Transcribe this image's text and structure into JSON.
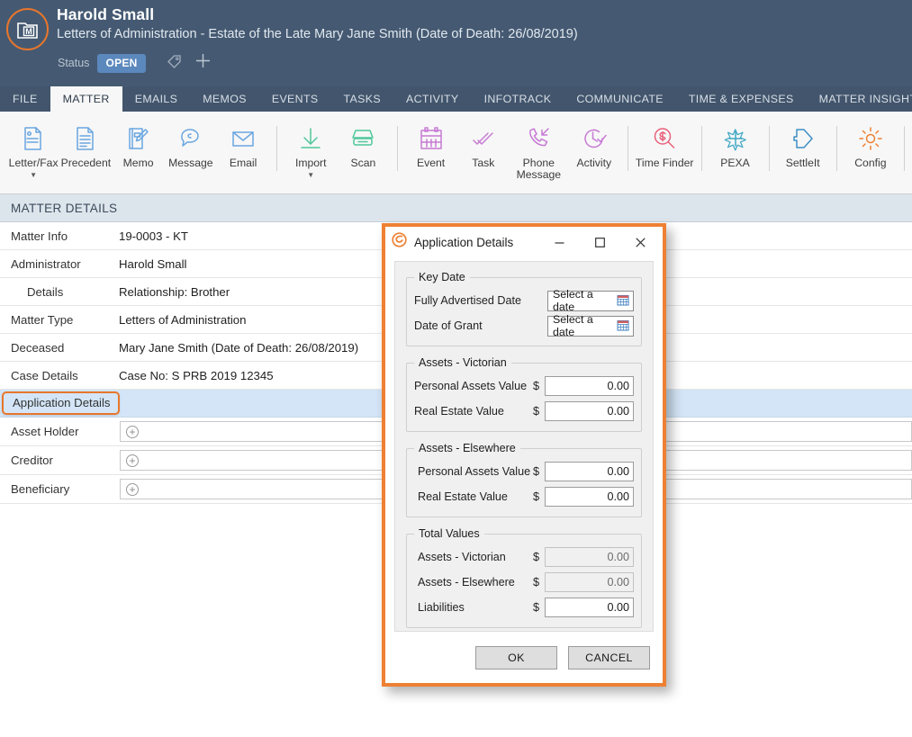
{
  "header": {
    "logo_icon": "matter-folder-m-icon",
    "client_name": "Harold Small",
    "matter_description": "Letters of Administration - Estate of the Late Mary Jane Smith (Date of Death: 26/08/2019)",
    "status_label": "Status",
    "status_value": "OPEN",
    "tag_icon": "tag-icon",
    "add_tag_icon": "plus-icon",
    "accent_color": "#e8762c",
    "background_color": "#455a72"
  },
  "tabs": [
    {
      "label": "FILE",
      "active": false
    },
    {
      "label": "MATTER",
      "active": true
    },
    {
      "label": "EMAILS",
      "active": false
    },
    {
      "label": "MEMOS",
      "active": false
    },
    {
      "label": "EVENTS",
      "active": false
    },
    {
      "label": "TASKS",
      "active": false
    },
    {
      "label": "ACTIVITY",
      "active": false
    },
    {
      "label": "INFOTRACK",
      "active": false
    },
    {
      "label": "COMMUNICATE",
      "active": false
    },
    {
      "label": "TIME & EXPENSES",
      "active": false
    },
    {
      "label": "MATTER INSIGHTS",
      "active": false
    }
  ],
  "ribbon": [
    {
      "label": "Letter/Fax",
      "icon": "letter-fax-icon",
      "color": "#6aa6e0",
      "caret": true
    },
    {
      "label": "Precedent",
      "icon": "precedent-document-icon",
      "color": "#6aa6e0",
      "caret": false
    },
    {
      "label": "Memo",
      "icon": "memo-notebook-pen-icon",
      "color": "#6aa6e0",
      "caret": false
    },
    {
      "label": "Message",
      "icon": "message-bubble-icon",
      "color": "#6aa6e0",
      "caret": false
    },
    {
      "label": "Email",
      "icon": "email-envelope-icon",
      "color": "#6aa6e0",
      "caret": false
    },
    {
      "separator": true
    },
    {
      "label": "Import",
      "icon": "import-download-icon",
      "color": "#4fc79a",
      "caret": true
    },
    {
      "label": "Scan",
      "icon": "scanner-icon",
      "color": "#4fc79a",
      "caret": false
    },
    {
      "separator": true
    },
    {
      "label": "Event",
      "icon": "calendar-event-icon",
      "color": "#c77ad4",
      "caret": false
    },
    {
      "label": "Task",
      "icon": "task-checks-icon",
      "color": "#c77ad4",
      "caret": false
    },
    {
      "label": "Phone Message",
      "icon": "phone-message-icon",
      "color": "#c77ad4",
      "caret": false
    },
    {
      "label": "Activity",
      "icon": "activity-clock-check-icon",
      "color": "#c77ad4",
      "caret": false
    },
    {
      "separator": true
    },
    {
      "label": "Time Finder",
      "icon": "time-finder-dollar-search-icon",
      "color": "#e8607a",
      "caret": false
    },
    {
      "separator": true
    },
    {
      "label": "PEXA",
      "icon": "pexa-star-icon",
      "color": "#3fa8c4",
      "caret": false
    },
    {
      "separator": true
    },
    {
      "label": "SettleIt",
      "icon": "settleit-arrow-icon",
      "color": "#3f8fc4",
      "caret": false
    },
    {
      "separator": true
    },
    {
      "label": "Config",
      "icon": "config-gear-icon",
      "color": "#ee8033",
      "caret": false
    },
    {
      "separator": true
    }
  ],
  "matter_details": {
    "section_title": "MATTER DETAILS",
    "rows": [
      {
        "label": "Matter Info",
        "value": "19-0003 - KT",
        "type": "text",
        "indent": false
      },
      {
        "label": "Administrator",
        "value": "Harold Small",
        "type": "text",
        "indent": false
      },
      {
        "label": "Details",
        "value": "Relationship: Brother",
        "type": "text",
        "indent": true
      },
      {
        "label": "Matter Type",
        "value": "Letters of Administration",
        "type": "text",
        "indent": false
      },
      {
        "label": "Deceased",
        "value": "Mary Jane Smith (Date of Death: 26/08/2019)",
        "type": "text",
        "indent": false
      },
      {
        "label": "Case Details",
        "value": "Case No: S PRB 2019 12345",
        "type": "text",
        "indent": false
      },
      {
        "label": "Application Details",
        "value": "",
        "type": "selected",
        "indent": false
      },
      {
        "label": "Asset Holder",
        "value": "",
        "type": "picker",
        "indent": false
      },
      {
        "label": "Creditor",
        "value": "",
        "type": "picker",
        "indent": false
      },
      {
        "label": "Beneficiary",
        "value": "",
        "type": "picker",
        "indent": false
      }
    ]
  },
  "dialog": {
    "title": "Application Details",
    "title_icon": "smokeball-s-logo-icon",
    "minimize_icon": "minimize-icon",
    "maximize_icon": "maximize-icon",
    "close_icon": "close-icon",
    "border_color": "#ee8033",
    "groups": [
      {
        "legend": "Key Date",
        "fields": [
          {
            "label": "Fully Advertised Date",
            "kind": "date",
            "value": "Select a date",
            "icon": "calendar-picker-icon"
          },
          {
            "label": "Date of Grant",
            "kind": "date",
            "value": "Select a date",
            "icon": "calendar-picker-icon"
          }
        ]
      },
      {
        "legend": "Assets - Victorian",
        "fields": [
          {
            "label": "Personal Assets Value",
            "kind": "currency",
            "prefix": "$",
            "value": "0.00",
            "readonly": false
          },
          {
            "label": "Real Estate Value",
            "kind": "currency",
            "prefix": "$",
            "value": "0.00",
            "readonly": false
          }
        ]
      },
      {
        "legend": "Assets - Elsewhere",
        "fields": [
          {
            "label": "Personal Assets Value",
            "kind": "currency",
            "prefix": "$",
            "value": "0.00",
            "readonly": false
          },
          {
            "label": "Real Estate Value",
            "kind": "currency",
            "prefix": "$",
            "value": "0.00",
            "readonly": false
          }
        ]
      },
      {
        "legend": "Total Values",
        "fields": [
          {
            "label": "Assets - Victorian",
            "kind": "currency",
            "prefix": "$",
            "value": "0.00",
            "readonly": true
          },
          {
            "label": "Assets - Elsewhere",
            "kind": "currency",
            "prefix": "$",
            "value": "0.00",
            "readonly": true
          },
          {
            "label": "Liabilities",
            "kind": "currency",
            "prefix": "$",
            "value": "0.00",
            "readonly": false
          }
        ]
      }
    ],
    "ok_label": "OK",
    "cancel_label": "CANCEL"
  }
}
